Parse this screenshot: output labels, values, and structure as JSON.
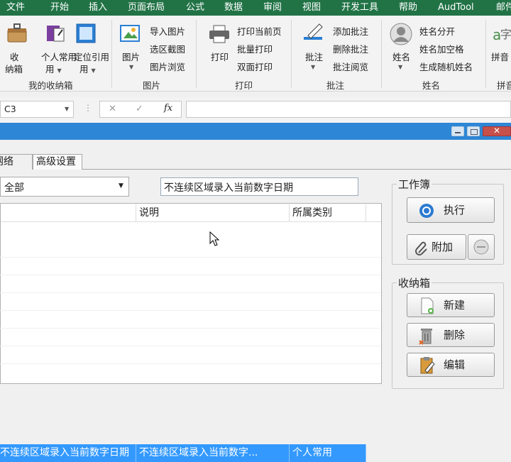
{
  "ribbon_tabs": [
    "文件",
    "开始",
    "插入",
    "页面布局",
    "公式",
    "数据",
    "审阅",
    "视图",
    "开发工具",
    "帮助",
    "AudTool",
    "邮件"
  ],
  "ribbon": {
    "storage_group": {
      "label": "我的收纳箱",
      "btn_box": "收纳箱",
      "btn_personal": "个人常用",
      "btn_locate": "定位引用"
    },
    "picture_group": {
      "label": "图片",
      "btn_picture": "图片",
      "import": "导入图片",
      "crop": "选区截图",
      "browse": "图片浏览"
    },
    "print_group": {
      "label": "打印",
      "btn_print": "打印",
      "current": "打印当前页",
      "batch": "批量打印",
      "duplex": "双面打印"
    },
    "comment_group": {
      "label": "批注",
      "btn_comment": "批注",
      "add": "添加批注",
      "delete": "删除批注",
      "browse": "批注阅览"
    },
    "name_group": {
      "label": "姓名",
      "btn_name": "姓名",
      "split": "姓名分开",
      "space": "姓名加空格",
      "random": "生成随机姓名"
    },
    "pinyin_group": {
      "label": "拼音",
      "btn_pinyin": "拼音"
    }
  },
  "formula_bar": {
    "name_box": "C3",
    "cancel": "✕",
    "confirm": "✓",
    "fx": "fx",
    "formula": ""
  },
  "dialog": {
    "tabs": [
      "网络",
      "高级设置"
    ],
    "category_select": "全部",
    "search_value": "不连续区域录入当前数字日期",
    "table": {
      "headers": [
        "",
        "说明",
        "所属类别"
      ],
      "rows": [
        [
          "不连续区域录入当前数字日期",
          "不连续区域录入当前数字...",
          "个人常用"
        ]
      ]
    },
    "workbook_group": {
      "title": "工作簿",
      "run": "执行",
      "attach": "附加"
    },
    "storage_group": {
      "title": "收纳箱",
      "new": "新建",
      "delete": "删除",
      "edit": "编辑"
    }
  },
  "colors": {
    "ribbon_green": "#217346",
    "selection_blue": "#3399ff",
    "titlebar_blue": "#2e86d6"
  }
}
